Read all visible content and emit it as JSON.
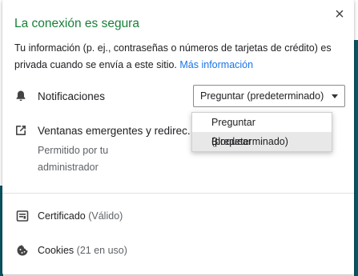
{
  "header": {
    "title": "La conexión es segura",
    "close_glyph": "×"
  },
  "description": {
    "text": "Tu información (p. ej., contraseñas o números de tarjetas de crédito) es privada cuando se envía a este sitio.",
    "link": "Más información"
  },
  "notifications": {
    "label": "Notificaciones",
    "icon": "bell-icon",
    "selected": "Preguntar (predeterminado)",
    "options": [
      "Preguntar (predeterminado)",
      "Bloquear"
    ]
  },
  "popups": {
    "label": "Ventanas emergentes y redirec.",
    "icon": "external-link-icon",
    "sub1": "Permitido por tu",
    "sub2": "administrador"
  },
  "certificate": {
    "label": "Certificado",
    "status": "(Válido)",
    "icon": "certificate-icon"
  },
  "cookies": {
    "label": "Cookies",
    "status": "(21 en uso)",
    "icon": "cookie-icon"
  },
  "colors": {
    "title_green": "#188038",
    "link_blue": "#1a73e8",
    "page_teal": "#0b5563"
  }
}
